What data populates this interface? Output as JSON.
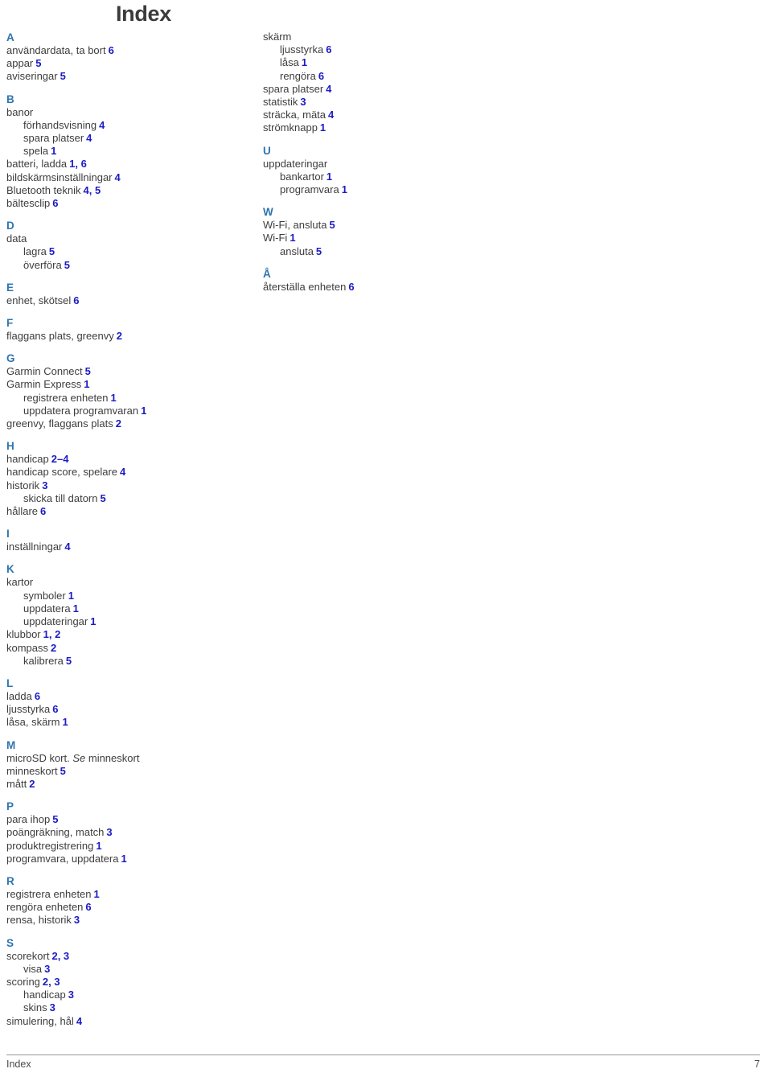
{
  "document": {
    "title": "Index",
    "footer_left": "Index",
    "footer_page_number": "7"
  },
  "colors": {
    "section_letter": "#2f74ae",
    "page_number": "#1b1bc4",
    "body_text": "#3d3d3d",
    "title": "#3b3b3b",
    "rule": "#9a9a9a"
  },
  "columns": {
    "left": [
      {
        "letter": "A",
        "entries": [
          {
            "text": "användardata, ta bort",
            "page": "6",
            "level": 0
          },
          {
            "text": "appar",
            "page": "5",
            "level": 0
          },
          {
            "text": "aviseringar",
            "page": "5",
            "level": 0
          }
        ]
      },
      {
        "letter": "B",
        "entries": [
          {
            "text": "banor",
            "page": "",
            "level": 0
          },
          {
            "text": "förhandsvisning",
            "page": "4",
            "level": 1
          },
          {
            "text": "spara platser",
            "page": "4",
            "level": 1
          },
          {
            "text": "spela",
            "page": "1",
            "level": 1
          },
          {
            "text": "batteri, ladda",
            "page": "1, 6",
            "level": 0
          },
          {
            "text": "bildskärmsinställningar",
            "page": "4",
            "level": 0
          },
          {
            "text": "Bluetooth teknik",
            "page": "4, 5",
            "level": 0
          },
          {
            "text": "bältesclip",
            "page": "6",
            "level": 0
          }
        ]
      },
      {
        "letter": "D",
        "entries": [
          {
            "text": "data",
            "page": "",
            "level": 0
          },
          {
            "text": "lagra",
            "page": "5",
            "level": 1
          },
          {
            "text": "överföra",
            "page": "5",
            "level": 1
          }
        ]
      },
      {
        "letter": "E",
        "entries": [
          {
            "text": "enhet, skötsel",
            "page": "6",
            "level": 0
          }
        ]
      },
      {
        "letter": "F",
        "entries": [
          {
            "text": "flaggans plats, greenvy",
            "page": "2",
            "level": 0
          }
        ]
      },
      {
        "letter": "G",
        "entries": [
          {
            "text": "Garmin Connect",
            "page": "5",
            "level": 0
          },
          {
            "text": "Garmin Express",
            "page": "1",
            "level": 0
          },
          {
            "text": "registrera enheten",
            "page": "1",
            "level": 1
          },
          {
            "text": "uppdatera programvaran",
            "page": "1",
            "level": 1
          },
          {
            "text": "greenvy, flaggans plats",
            "page": "2",
            "level": 0
          }
        ]
      },
      {
        "letter": "H",
        "entries": [
          {
            "text": "handicap",
            "page": "2–4",
            "level": 0
          },
          {
            "text": "handicap score, spelare",
            "page": "4",
            "level": 0
          },
          {
            "text": "historik",
            "page": "3",
            "level": 0
          },
          {
            "text": "skicka till datorn",
            "page": "5",
            "level": 1
          },
          {
            "text": "hållare",
            "page": "6",
            "level": 0
          }
        ]
      },
      {
        "letter": "I",
        "entries": [
          {
            "text": "inställningar",
            "page": "4",
            "level": 0
          }
        ]
      },
      {
        "letter": "K",
        "entries": [
          {
            "text": "kartor",
            "page": "",
            "level": 0
          },
          {
            "text": "symboler",
            "page": "1",
            "level": 1
          },
          {
            "text": "uppdatera",
            "page": "1",
            "level": 1
          },
          {
            "text": "uppdateringar",
            "page": "1",
            "level": 1
          },
          {
            "text": "klubbor",
            "page": "1, 2",
            "level": 0
          },
          {
            "text": "kompass",
            "page": "2",
            "level": 0
          },
          {
            "text": "kalibrera",
            "page": "5",
            "level": 1
          }
        ]
      },
      {
        "letter": "L",
        "entries": [
          {
            "text": "ladda",
            "page": "6",
            "level": 0
          },
          {
            "text": "ljusstyrka",
            "page": "6",
            "level": 0
          },
          {
            "text": "låsa, skärm",
            "page": "1",
            "level": 0
          }
        ]
      },
      {
        "letter": "M",
        "entries": [
          {
            "text": "microSD kort. ",
            "italic": "Se",
            "text_after": " minneskort",
            "page": "",
            "level": 0
          },
          {
            "text": "minneskort",
            "page": "5",
            "level": 0
          },
          {
            "text": "mått",
            "page": "2",
            "level": 0
          }
        ]
      },
      {
        "letter": "P",
        "entries": [
          {
            "text": "para ihop",
            "page": "5",
            "level": 0
          },
          {
            "text": "poängräkning, match",
            "page": "3",
            "level": 0
          },
          {
            "text": "produktregistrering",
            "page": "1",
            "level": 0
          },
          {
            "text": "programvara, uppdatera",
            "page": "1",
            "level": 0
          }
        ]
      },
      {
        "letter": "R",
        "entries": [
          {
            "text": "registrera enheten",
            "page": "1",
            "level": 0
          },
          {
            "text": "rengöra enheten",
            "page": "6",
            "level": 0
          },
          {
            "text": "rensa, historik",
            "page": "3",
            "level": 0
          }
        ]
      },
      {
        "letter": "S",
        "entries": [
          {
            "text": "scorekort",
            "page": "2, 3",
            "level": 0
          },
          {
            "text": "visa",
            "page": "3",
            "level": 1
          },
          {
            "text": "scoring",
            "page": "2, 3",
            "level": 0
          },
          {
            "text": "handicap",
            "page": "3",
            "level": 1
          },
          {
            "text": "skins",
            "page": "3",
            "level": 1
          },
          {
            "text": "simulering, hål",
            "page": "4",
            "level": 0
          }
        ]
      }
    ],
    "right": [
      {
        "letter": "",
        "entries": [
          {
            "text": "skärm",
            "page": "",
            "level": 0
          },
          {
            "text": "ljusstyrka",
            "page": "6",
            "level": 1
          },
          {
            "text": "låsa",
            "page": "1",
            "level": 1
          },
          {
            "text": "rengöra",
            "page": "6",
            "level": 1
          },
          {
            "text": "spara platser",
            "page": "4",
            "level": 0
          },
          {
            "text": "statistik",
            "page": "3",
            "level": 0
          },
          {
            "text": "sträcka, mäta",
            "page": "4",
            "level": 0
          },
          {
            "text": "strömknapp",
            "page": "1",
            "level": 0
          }
        ]
      },
      {
        "letter": "U",
        "entries": [
          {
            "text": "uppdateringar",
            "page": "",
            "level": 0
          },
          {
            "text": "bankartor",
            "page": "1",
            "level": 1
          },
          {
            "text": "programvara",
            "page": "1",
            "level": 1
          }
        ]
      },
      {
        "letter": "W",
        "entries": [
          {
            "text": "Wi-Fi, ansluta",
            "page": "5",
            "level": 0
          },
          {
            "text": "Wi-Fi",
            "page": "1",
            "level": 0
          },
          {
            "text": "ansluta",
            "page": "5",
            "level": 1
          }
        ]
      },
      {
        "letter": "Å",
        "entries": [
          {
            "text": "återställa enheten",
            "page": "6",
            "level": 0
          }
        ]
      }
    ]
  }
}
